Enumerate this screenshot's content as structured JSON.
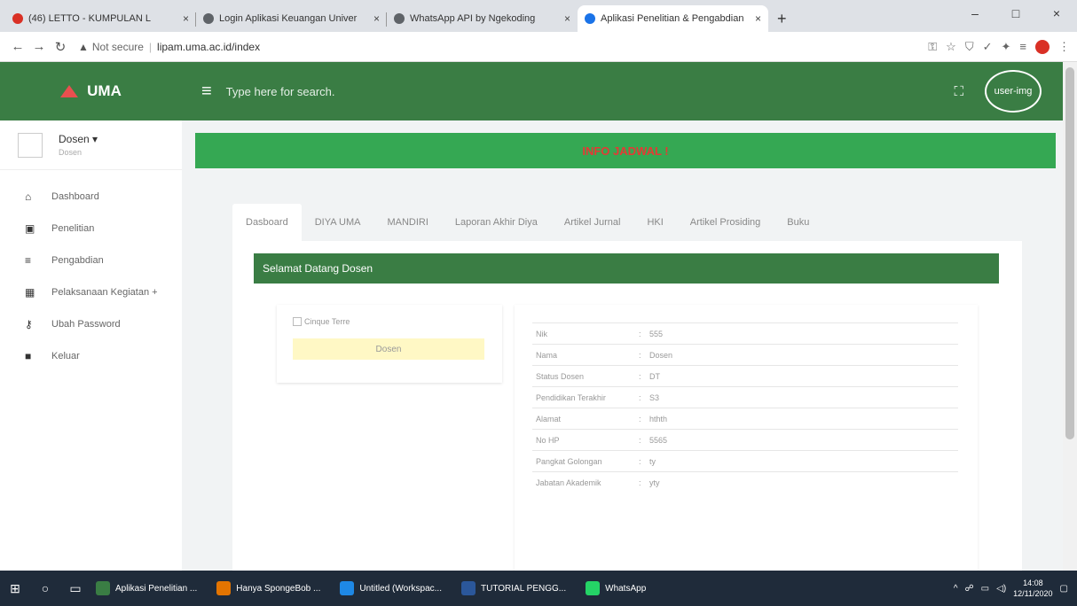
{
  "browser": {
    "tabs": [
      {
        "title": "(46) LETTO - KUMPULAN L",
        "close": "×",
        "color": "#d93025"
      },
      {
        "title": "Login Aplikasi Keuangan Univer",
        "close": "×",
        "color": "#5f6368"
      },
      {
        "title": "WhatsApp API by Ngekoding",
        "close": "×",
        "color": "#5f6368"
      },
      {
        "title": "Aplikasi Penelitian & Pengabdian",
        "close": "×",
        "color": "#1a73e8"
      }
    ],
    "new_tab": "+",
    "window_controls": {
      "minimize": "–",
      "maximize": "□",
      "close": "×"
    },
    "address": {
      "security_label": "Not secure",
      "url": "lipam.uma.ac.id/index"
    }
  },
  "app": {
    "brand": "UMA",
    "search_placeholder": "Type here for search.",
    "user_img_alt": "user-img",
    "info_banner": "INFO JADWAL !",
    "sidebar": {
      "user_name": "Dosen ▾",
      "user_role": "Dosen",
      "items": [
        {
          "label": "Dashboard",
          "icon": "home-icon",
          "glyph": "⌂"
        },
        {
          "label": "Penelitian",
          "icon": "book-icon",
          "glyph": "▣"
        },
        {
          "label": "Pengabdian",
          "icon": "list-icon",
          "glyph": "≡"
        },
        {
          "label": "Pelaksanaan Kegiatan +",
          "icon": "grid-icon",
          "glyph": "▦"
        },
        {
          "label": "Ubah Password",
          "icon": "key-icon",
          "glyph": "⚷"
        },
        {
          "label": "Keluar",
          "icon": "lock-icon",
          "glyph": "🔒"
        }
      ]
    },
    "tabs": [
      "Dasboard",
      "DIYA UMA",
      "MANDIRI",
      "Laporan Akhir Diya",
      "Artikel Jurnal",
      "HKI",
      "Artikel Prosiding",
      "Buku"
    ],
    "welcome": "Selamat Datang Dosen",
    "profile_image_alt": "Cinque Terre",
    "role_badge": "Dosen",
    "details": [
      {
        "label": "Nik",
        "value": "555"
      },
      {
        "label": "Nama",
        "value": "Dosen"
      },
      {
        "label": "Status Dosen",
        "value": "DT"
      },
      {
        "label": "Pendidikan Terakhir",
        "value": "S3"
      },
      {
        "label": "Alamat",
        "value": "hthth"
      },
      {
        "label": "No HP",
        "value": "5565"
      },
      {
        "label": "Pangkat Golongan",
        "value": "ty"
      },
      {
        "label": "Jabatan Akademik",
        "value": "yty"
      }
    ]
  },
  "taskbar": {
    "apps": [
      {
        "label": "Aplikasi Penelitian ...",
        "color": "#3a7d44"
      },
      {
        "label": "Hanya SpongeBob ...",
        "color": "#e37400"
      },
      {
        "label": "Untitled (Workspac...",
        "color": "#1e88e5"
      },
      {
        "label": "TUTORIAL PENGG...",
        "color": "#2b579a"
      },
      {
        "label": "WhatsApp",
        "color": "#25d366"
      }
    ],
    "time": "14:08",
    "date": "12/11/2020"
  }
}
